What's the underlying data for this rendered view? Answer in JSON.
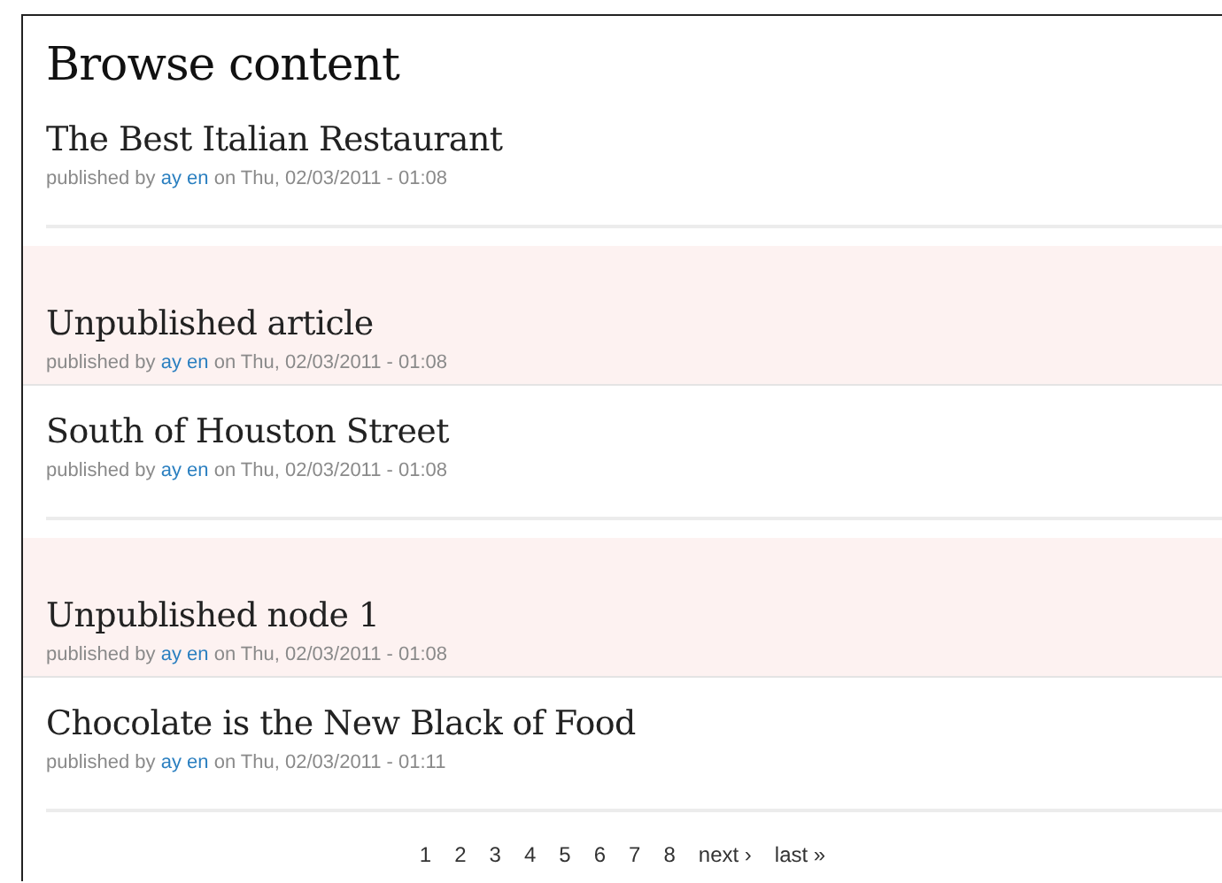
{
  "heading": "Browse content",
  "nodes": [
    {
      "title": "The Best Italian Restaurant",
      "published": true,
      "byline": "published by",
      "author": "ay en",
      "date": "on Thu, 02/03/2011 - 01:08"
    },
    {
      "title": "Unpublished article",
      "published": false,
      "byline": "published by",
      "author": "ay en",
      "date": "on Thu, 02/03/2011 - 01:08"
    },
    {
      "title": "South of Houston Street",
      "published": true,
      "byline": "published by",
      "author": "ay en",
      "date": "on Thu, 02/03/2011 - 01:08"
    },
    {
      "title": "Unpublished node 1",
      "published": false,
      "byline": "published by",
      "author": "ay en",
      "date": "on Thu, 02/03/2011 - 01:08"
    },
    {
      "title": "Chocolate is the New Black of Food",
      "published": true,
      "byline": "published by",
      "author": "ay en",
      "date": "on Thu, 02/03/2011 - 01:11"
    }
  ],
  "pager": [
    "1",
    "2",
    "3",
    "4",
    "5",
    "6",
    "7",
    "8",
    "next ›",
    "last »"
  ]
}
